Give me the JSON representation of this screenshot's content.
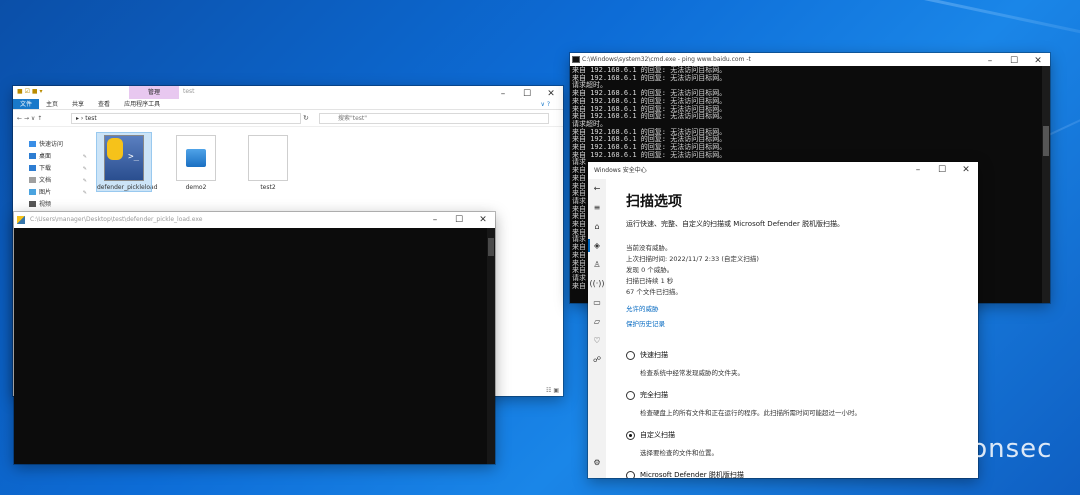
{
  "explorer": {
    "manage_tab": "管理",
    "window_name": "test",
    "ribbon": [
      "文件",
      "主页",
      "共享",
      "查看",
      "应用程序工具"
    ],
    "path": "test",
    "search_placeholder": "搜索\"test\"",
    "nav": [
      {
        "label": "快速访问"
      },
      {
        "label": "桌面"
      },
      {
        "label": "下载"
      },
      {
        "label": "文档"
      },
      {
        "label": "图片"
      },
      {
        "label": "视频"
      }
    ],
    "files": [
      {
        "name": "defender_pickleload"
      },
      {
        "name": "demo2"
      },
      {
        "name": "test2"
      }
    ]
  },
  "pycon": {
    "title": "C:\\Users\\manager\\Desktop\\test\\defender_pickle_load.exe"
  },
  "cmd": {
    "title": "C:\\Windows\\system32\\cmd.exe - ping  www.baidu.com -t",
    "lines": [
      "来自 192.168.6.1 的回复: 无法访问目标网。",
      "来自 192.168.6.1 的回复: 无法访问目标网。",
      "请求超时。",
      "来自 192.168.6.1 的回复: 无法访问目标网。",
      "来自 192.168.6.1 的回复: 无法访问目标网。",
      "来自 192.168.6.1 的回复: 无法访问目标网。",
      "来自 192.168.6.1 的回复: 无法访问目标网。",
      "请求超时。",
      "来自 192.168.6.1 的回复: 无法访问目标网。",
      "来自 192.168.6.1 的回复: 无法访问目标网。",
      "来自 192.168.6.1 的回复: 无法访问目标网。",
      "来自 192.168.6.1 的回复: 无法访问目标网。",
      "请求",
      "来自",
      "来自",
      "来自",
      "来自",
      "请求",
      "来自",
      "来自",
      "来自",
      "来自",
      "请求",
      "来自",
      "来自",
      "来自",
      "来自",
      "请求",
      "来自"
    ]
  },
  "security": {
    "window_title": "Windows 安全中心",
    "heading": "扫描选项",
    "subtitle": "运行快速、完整、自定义的扫描或 Microsoft Defender 脱机版扫描。",
    "status": [
      "当前没有威胁。",
      "上次扫描时间: 2022/11/7 2:33 (自定义扫描)",
      "发现 0 个威胁。",
      "扫描已持续 1 秒",
      "67 个文件已扫描。"
    ],
    "links": [
      "允许的威胁",
      "保护历史记录"
    ],
    "options": [
      {
        "label": "快速扫描",
        "desc": "检查系统中经常发现威胁的文件夹。",
        "selected": false
      },
      {
        "label": "完全扫描",
        "desc": "检查硬盘上的所有文件和正在运行的程序。此扫描所需时间可能超过一小时。",
        "selected": false
      },
      {
        "label": "自定义扫描",
        "desc": "选择要检查的文件和位置。",
        "selected": true
      },
      {
        "label": "Microsoft Defender 脱机版扫描",
        "desc": "",
        "selected": false
      }
    ]
  },
  "watermark": "moonsec"
}
